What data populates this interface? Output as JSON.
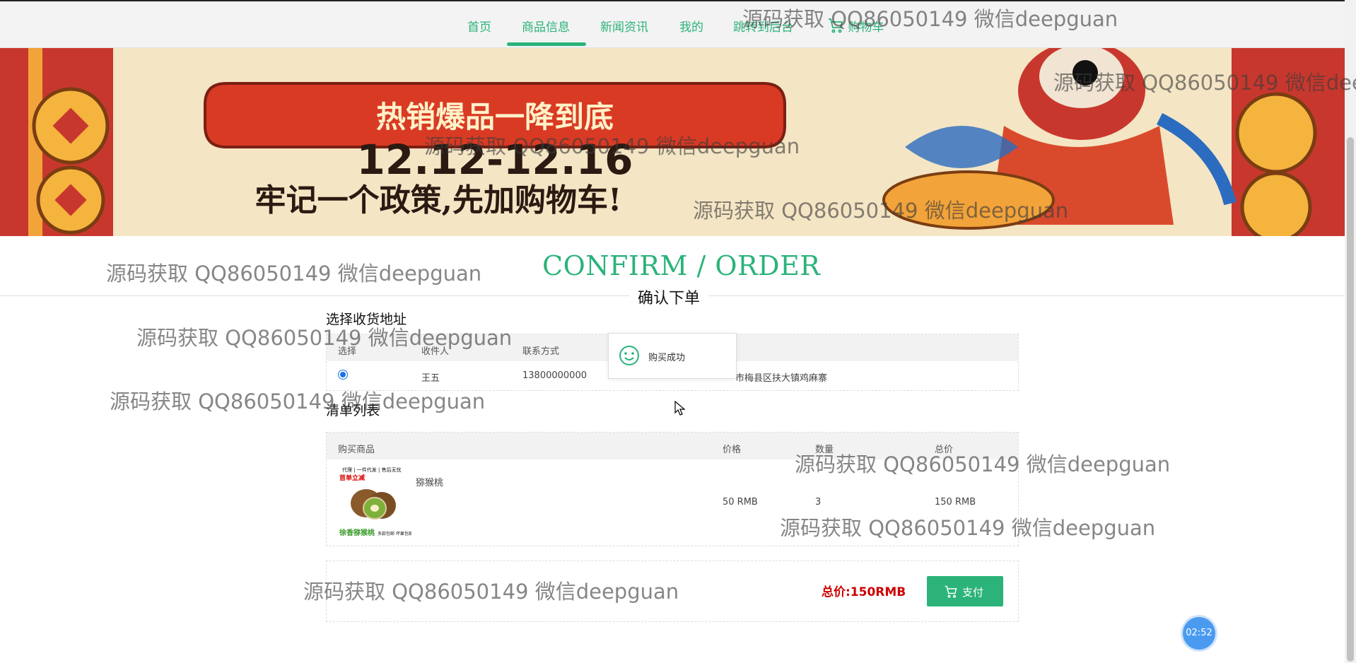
{
  "nav": {
    "items": [
      "首页",
      "商品信息",
      "新闻资讯",
      "我的",
      "跳转到后台",
      "购物车"
    ],
    "active": "商品信息"
  },
  "banner": {
    "headline": "热销爆品一降到底",
    "dates": "12.12-12.16",
    "slogan": "牢记一个政策,先加购物车!"
  },
  "page": {
    "title": "CONFIRM / ORDER",
    "subtitle": "确认下单"
  },
  "address": {
    "section_label": "选择收货地址",
    "headers": [
      "选择",
      "收件人",
      "联系方式"
    ],
    "row": {
      "name": "王五",
      "phone": "13800000000",
      "address": "市梅县区扶大镇鸡麻寨",
      "selected": true
    }
  },
  "toast": {
    "text": "购买成功",
    "icon": "smile-icon"
  },
  "order": {
    "section_label": "清单列表",
    "headers": [
      "购买商品",
      "价格",
      "数量",
      "总价"
    ],
    "items": [
      {
        "name": "猕猴桃",
        "price": "50 RMB",
        "qty": "3",
        "total": "150 RMB",
        "img_text_top": "代理 | 一件代发 | 售后无忧",
        "img_badge": "首单立减",
        "img_text_bottom": "徐香猕猴桃",
        "img_tag": "多款包邮 坏果包赔"
      }
    ]
  },
  "summary": {
    "total": "总价:150RMB",
    "pay_label": "支付"
  },
  "timer": {
    "value": "02:52"
  },
  "watermark": {
    "text": "源码获取 QQ86050149 微信deepguan"
  },
  "colors": {
    "accent": "#2bb37a",
    "price_red": "#cc0000",
    "timer_blue": "#4a9bf0"
  }
}
